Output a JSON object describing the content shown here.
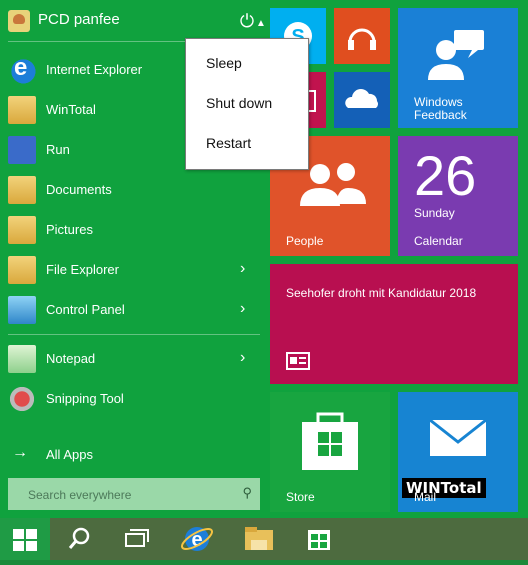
{
  "user": {
    "name": "PCD panfee"
  },
  "power_menu": {
    "items": [
      "Sleep",
      "Shut down",
      "Restart"
    ]
  },
  "menu": {
    "items": [
      {
        "label": "Internet Explorer"
      },
      {
        "label": "WinTotal"
      },
      {
        "label": "Run"
      },
      {
        "label": "Documents"
      },
      {
        "label": "Pictures"
      },
      {
        "label": "File Explorer"
      },
      {
        "label": "Control Panel"
      },
      {
        "label": "Notepad"
      },
      {
        "label": "Snipping Tool"
      }
    ],
    "all_apps": "All Apps"
  },
  "search": {
    "placeholder": "Search everywhere"
  },
  "tiles": {
    "windows_feedback": "Windows Feedback",
    "people": "People",
    "calendar": {
      "day_number": "26",
      "weekday": "Sunday",
      "label": "Calendar"
    },
    "news": "Seehofer droht mit Kandidatur 2018",
    "store": "Store",
    "mail": "Mail"
  },
  "watermark": "WINTotal",
  "colors": {
    "start_bg": "#10a23e",
    "skype": "#00aff0",
    "music": "#e04e1f",
    "onedrive": "#1460b7",
    "feedback": "#1a80d6",
    "people": "#e0532a",
    "calendar": "#7a3bb0",
    "news": "#b80f50",
    "store": "#18a540",
    "mail": "#1784d2"
  }
}
